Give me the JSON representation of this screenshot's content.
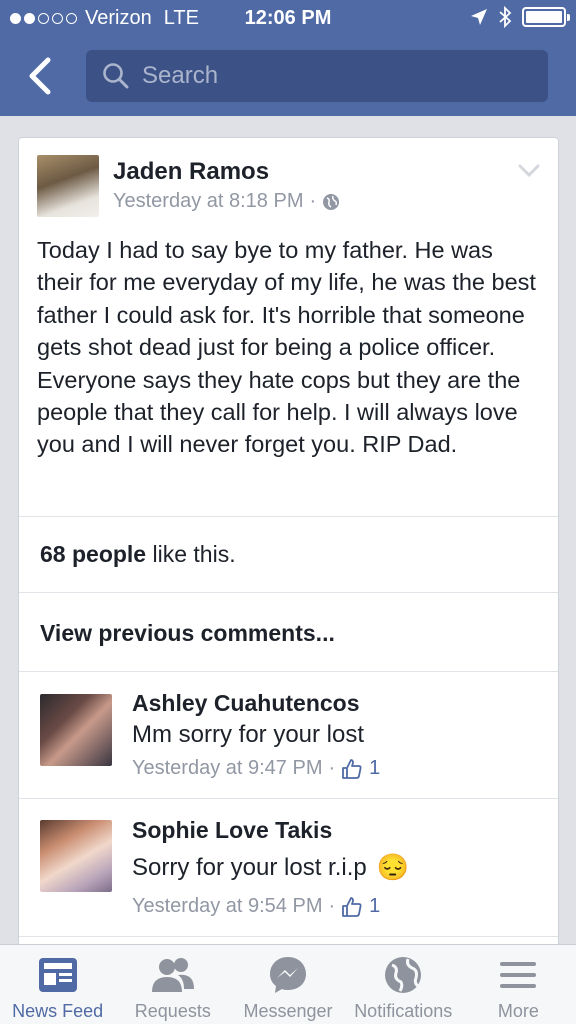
{
  "status_bar": {
    "carrier": "Verizon",
    "network": "LTE",
    "time": "12:06 PM"
  },
  "search": {
    "placeholder": "Search"
  },
  "post": {
    "author": "Jaden Ramos",
    "timestamp": "Yesterday at 8:18 PM",
    "separator": "·",
    "text": "Today I had to say bye to my father. He was their for me everyday of my life, he was the best father I could ask for. It's horrible that someone gets shot dead just for being a police officer. Everyone says they hate cops but they are the people that they call for help. I will always love you and I will never forget you. RIP Dad.",
    "likes_count": "68 people",
    "likes_suffix": " like this.",
    "view_previous": "View previous comments..."
  },
  "comments": [
    {
      "name": "Ashley Cuahutencos",
      "text": "Mm sorry for your lost",
      "timestamp": "Yesterday at 9:47 PM",
      "separator": "·",
      "likes": "1"
    },
    {
      "name": "Sophie Love Takis",
      "text": "Sorry for your lost r.i.p",
      "emoji": "😔",
      "timestamp": "Yesterday at 9:54 PM",
      "separator": "·",
      "likes": "1"
    }
  ],
  "tabs": [
    {
      "label": "News Feed",
      "icon": "news-feed-icon",
      "active": true
    },
    {
      "label": "Requests",
      "icon": "friend-requests-icon",
      "active": false
    },
    {
      "label": "Messenger",
      "icon": "messenger-icon",
      "active": false
    },
    {
      "label": "Notifications",
      "icon": "globe-icon",
      "active": false
    },
    {
      "label": "More",
      "icon": "menu-icon",
      "active": false
    }
  ],
  "colors": {
    "brand": "#4f6aa5",
    "search_bg": "#3c5287",
    "text": "#1d2129",
    "meta": "#9197a3",
    "tab_inactive": "#8e939d"
  }
}
